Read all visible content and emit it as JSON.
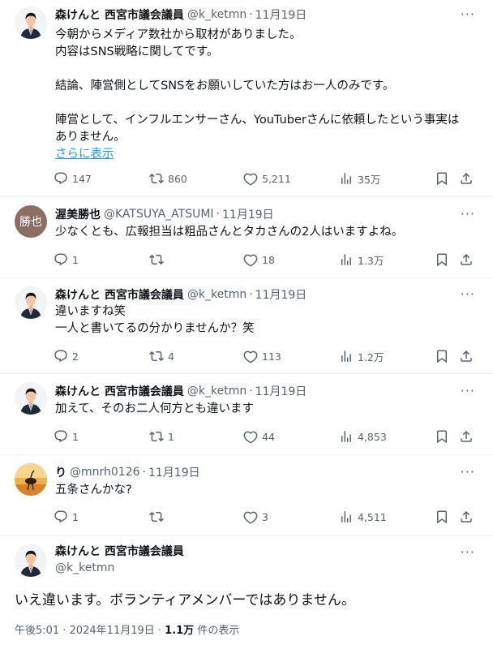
{
  "tweets": [
    {
      "name": "森けんと 西宮市議会議員",
      "handle": "@k_ketmn",
      "date": "11月19日",
      "lines": [
        "今朝からメディア数社から取材がありました。",
        "内容はSNS戦略に関してです。",
        "",
        "結論、陣営側としてSNSをお願いしていた方はお一人のみです。",
        "",
        "陣営として、インフルエンサーさん、YouTuberさんに依頼したという事実は",
        "ありません。"
      ],
      "show_more": "さらに表示",
      "replies": "147",
      "retweets": "860",
      "likes": "5,211",
      "views": "35万"
    },
    {
      "name": "渥美勝也",
      "handle": "@KATSUYA_ATSUMI",
      "date": "11月19日",
      "avatar_text": "勝也",
      "lines": [
        "少なくとも、広報担当は粗品さんとタカさんの2人はいますよね。"
      ],
      "replies": "1",
      "retweets": "",
      "likes": "18",
      "views": "1.3万"
    },
    {
      "name": "森けんと 西宮市議会議員",
      "handle": "@k_ketmn",
      "date": "11月19日",
      "lines": [
        "違いますね笑",
        "一人と書いてるの分かりませんか？笑"
      ],
      "replies": "2",
      "retweets": "4",
      "likes": "113",
      "views": "1.2万"
    },
    {
      "name": "森けんと 西宮市議会議員",
      "handle": "@k_ketmn",
      "date": "11月19日",
      "lines": [
        "加えて、そのお二人何方とも違います"
      ],
      "replies": "1",
      "retweets": "1",
      "likes": "44",
      "views": "4,853"
    },
    {
      "name": "り",
      "handle": "@mnrh0126",
      "date": "11月19日",
      "lines": [
        "五条さんかな?"
      ],
      "replies": "1",
      "retweets": "",
      "likes": "3",
      "views": "4,511"
    }
  ],
  "main": {
    "name": "森けんと 西宮市議会議員",
    "handle": "@k_ketmn",
    "text": "いえ違います。ボランティアメンバーではありません。",
    "time": "午後5:01 · 2024年11月19日 · ",
    "views_count": "1.1万",
    "views_label": " 件の表示"
  },
  "ui": {
    "dot": "·",
    "more": "···"
  },
  "colors": {
    "accent": "#1d9bf0",
    "muted": "#536471",
    "line": "#cfd9de"
  }
}
